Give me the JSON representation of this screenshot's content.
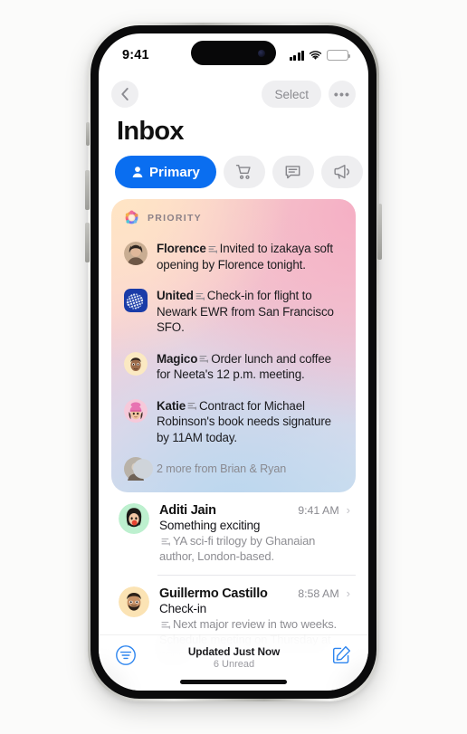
{
  "status_bar": {
    "time": "9:41",
    "icons": {
      "cellular": "signal-bars-icon",
      "wifi": "wifi-icon",
      "battery": "battery-icon"
    }
  },
  "nav": {
    "back_icon": "chevron-left-icon",
    "select_label": "Select",
    "more_label": "•••",
    "more_icon": "ellipsis-icon"
  },
  "page": {
    "title": "Inbox"
  },
  "filters": [
    {
      "label": "Primary",
      "icon": "person-icon",
      "selected": true
    },
    {
      "label": "",
      "icon": "cart-icon",
      "selected": false
    },
    {
      "label": "",
      "icon": "chat-bubble-icon",
      "selected": false
    },
    {
      "label": "",
      "icon": "megaphone-icon",
      "selected": false
    }
  ],
  "priority": {
    "header_label": "PRIORITY",
    "header_icon": "apple-intelligence-ring-icon",
    "items": [
      {
        "sender": "Florence",
        "summary": "Invited to izakaya soft opening by Florence tonight.",
        "avatar": "photo-woman"
      },
      {
        "sender": "United",
        "summary": "Check-in for flight to Newark EWR from San Francisco SFO.",
        "avatar": "united-logo"
      },
      {
        "sender": "Magico",
        "summary": "Order lunch and coffee for Neeta's 12 p.m. meeting.",
        "avatar": "memoji-man"
      },
      {
        "sender": "Katie",
        "summary": "Contract for Michael Robinson's book needs signature by 11AM today.",
        "avatar": "memoji-woman-pink-hat"
      }
    ],
    "more_text": "2 more from Brian & Ryan",
    "more_avatar": "stacked-avatars"
  },
  "messages": [
    {
      "sender": "Aditi Jain",
      "time": "9:41 AM",
      "subject": "Something exciting",
      "preview": "YA sci-fi trilogy by Ghanaian author, London-based.",
      "avatar": "memoji-woman-green",
      "chevron": "chevron-right-icon"
    },
    {
      "sender": "Guillermo Castillo",
      "time": "8:58 AM",
      "subject": "Check-in",
      "preview": "Next major review in two weeks. Schedule meeting on Thursday at noon.",
      "avatar": "memoji-man-beard",
      "chevron": "chevron-right-icon"
    }
  ],
  "toolbar": {
    "filter_icon": "filter-icon",
    "status_title": "Updated Just Now",
    "status_sub": "6 Unread",
    "compose_icon": "compose-icon"
  },
  "colors": {
    "accent": "#0a6ef0",
    "chip_bg": "#eeeef0",
    "secondary_text": "#8e8e93",
    "card_gradient_start": "#fde6cd",
    "card_gradient_mid": "#f6cfd6",
    "card_gradient_end": "#cfe0ef"
  }
}
